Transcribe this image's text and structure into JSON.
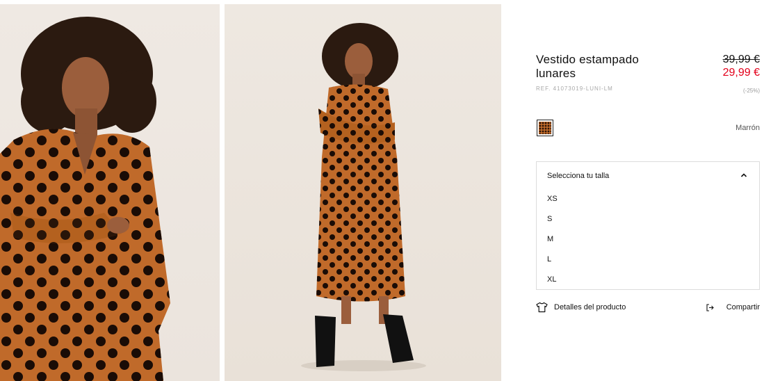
{
  "product": {
    "title": "Vestido estampado lunares",
    "ref": "REF. 41073019-LUNI-LM",
    "price_old": "39,99 €",
    "price_new": "29,99 €",
    "discount": "(-25%)"
  },
  "color": {
    "name": "Marrón",
    "swatch_icon": "polka-dot-swatch",
    "swatch_color": "#c06a2a"
  },
  "size_selector": {
    "label": "Selecciona tu talla",
    "expanded": true,
    "options": [
      "XS",
      "S",
      "M",
      "L",
      "XL"
    ]
  },
  "actions": {
    "details_label": "Detalles del producto",
    "details_icon": "tshirt-icon",
    "share_label": "Compartir",
    "share_icon": "share-icon"
  },
  "colors": {
    "price_sale": "#e3001b",
    "dress": "#c06a2a",
    "dots": "#1a0c06"
  }
}
